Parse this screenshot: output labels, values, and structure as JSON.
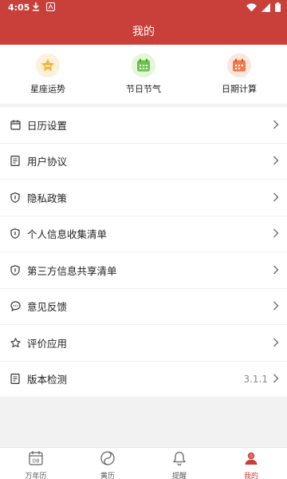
{
  "status_bar": {
    "time": "4:05",
    "left_icons": [
      "download-icon",
      "app-notification-icon"
    ],
    "right_icons": [
      "wifi-icon",
      "signal-icon",
      "battery-icon"
    ]
  },
  "app_bar": {
    "title": "我的"
  },
  "quick_actions": [
    {
      "label": "星座运势",
      "icon": "star-icon"
    },
    {
      "label": "节日节气",
      "icon": "calendar-icon"
    },
    {
      "label": "日期计算",
      "icon": "calendar-calc-icon"
    }
  ],
  "menu": [
    {
      "label": "日历设置",
      "icon": "calendar-settings-icon"
    },
    {
      "label": "用户协议",
      "icon": "document-icon"
    },
    {
      "label": "隐私政策",
      "icon": "shield-info-icon"
    },
    {
      "label": "个人信息收集清单",
      "icon": "shield-info-icon"
    },
    {
      "label": "第三方信息共享清单",
      "icon": "shield-info-icon"
    },
    {
      "label": "意见反馈",
      "icon": "chat-bubble-icon"
    },
    {
      "label": "评价应用",
      "icon": "star-outline-icon"
    },
    {
      "label": "版本检测",
      "icon": "document-icon",
      "value": "3.1.1"
    }
  ],
  "tabs": [
    {
      "label": "万年历",
      "icon": "calendar-08-icon",
      "active": false
    },
    {
      "label": "黄历",
      "icon": "yin-yang-icon",
      "active": false
    },
    {
      "label": "提醒",
      "icon": "bell-icon",
      "active": false
    },
    {
      "label": "我的",
      "icon": "user-icon",
      "active": true
    }
  ],
  "colors": {
    "primary": "#c9403a",
    "background": "#f2f2f2",
    "text": "#222222",
    "muted": "#888888"
  }
}
